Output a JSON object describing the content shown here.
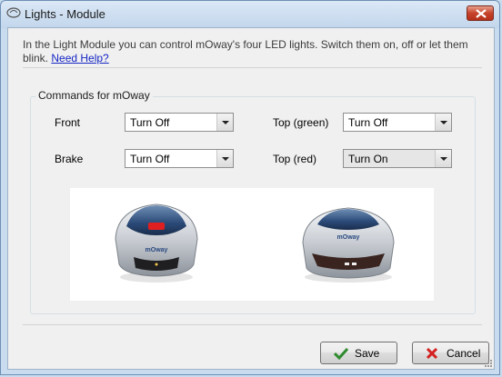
{
  "window": {
    "title": "Lights - Module"
  },
  "intro": {
    "text": "In the Light Module you can control mOway's four LED lights. Switch them on, off or let them blink.",
    "help_link": "Need Help?"
  },
  "group": {
    "title": "Commands for mOway"
  },
  "lights": {
    "front": {
      "label": "Front",
      "value": "Turn Off"
    },
    "top_green": {
      "label": "Top (green)",
      "value": "Turn Off"
    },
    "brake": {
      "label": "Brake",
      "value": "Turn Off"
    },
    "top_red": {
      "label": "Top (red)",
      "value": "Turn On"
    }
  },
  "robot_brand": "mOway",
  "buttons": {
    "save": "Save",
    "cancel": "Cancel"
  },
  "colors": {
    "save_icon": "#2e8b2e",
    "cancel_icon": "#d42020",
    "front_led": "#e02020",
    "link": "#1526c4"
  }
}
